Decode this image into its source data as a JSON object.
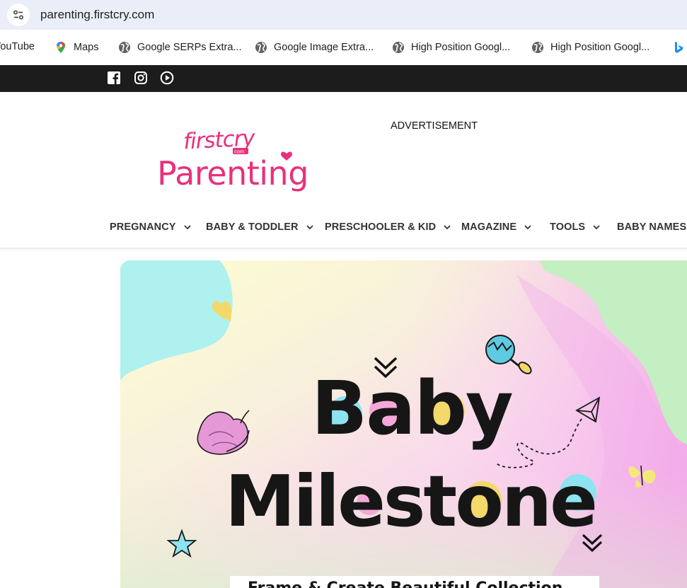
{
  "browser": {
    "url": "parenting.firstcry.com"
  },
  "bookmarks": [
    {
      "label": "YouTube",
      "icon": "youtube-icon"
    },
    {
      "label": "Maps",
      "icon": "maps-pin-icon"
    },
    {
      "label": "Google SERPs Extra...",
      "icon": "globe-icon"
    },
    {
      "label": "Google Image Extra...",
      "icon": "globe-icon"
    },
    {
      "label": "High Position Googl...",
      "icon": "globe-icon"
    },
    {
      "label": "High Position Googl...",
      "icon": "globe-icon"
    },
    {
      "label": "",
      "icon": "bing-icon"
    }
  ],
  "social": [
    "facebook-icon",
    "instagram-icon",
    "play-icon"
  ],
  "logo": {
    "line1": "firstcry",
    "line1_small": "com",
    "line2": "Parenting",
    "color": "#e8317c"
  },
  "ad": {
    "label": "ADVERTISEMENT"
  },
  "nav": {
    "items": [
      {
        "label": "PREGNANCY",
        "has_dropdown": true
      },
      {
        "label": "BABY & TODDLER",
        "has_dropdown": true
      },
      {
        "label": "PRESCHOOLER & KID",
        "has_dropdown": true
      },
      {
        "label": "MAGAZINE",
        "has_dropdown": true
      },
      {
        "label": "TOOLS",
        "has_dropdown": true
      },
      {
        "label": "BABY NAMES",
        "has_dropdown": false
      }
    ]
  },
  "banner": {
    "title_line1": "Baby",
    "title_line2": "Milestone",
    "subtitle": "Frame & Create Beautiful Collection"
  },
  "colors": {
    "logo_pink": "#e8317c",
    "social_bar": "#1c1c1c",
    "address_bar": "#eaeef9",
    "banner_cyan": "#a8f0f0",
    "banner_green": "#c3f0c0",
    "banner_pink": "#f7b6e8"
  }
}
